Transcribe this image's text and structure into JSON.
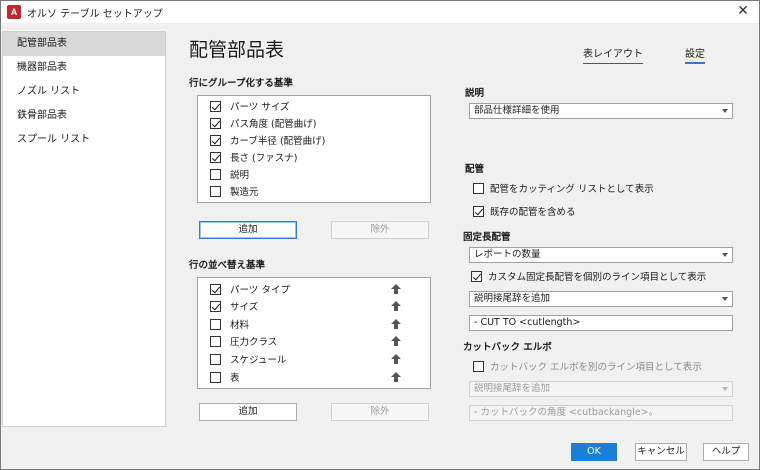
{
  "window": {
    "title": "オルソ テーブル セットアップ",
    "app_icon_letter": "A",
    "close_glyph": "✕"
  },
  "sidebar": {
    "items": [
      {
        "label": "配管部品表",
        "active": true
      },
      {
        "label": "機器部品表",
        "active": false
      },
      {
        "label": "ノズル リスト",
        "active": false
      },
      {
        "label": "鉄骨部品表",
        "active": false
      },
      {
        "label": "スプール リスト",
        "active": false
      }
    ]
  },
  "main": {
    "title": "配管部品表",
    "tabs": [
      {
        "label": "表レイアウト"
      },
      {
        "label": "設定"
      }
    ]
  },
  "group_rows": {
    "label": "行にグループ化する基準",
    "items": [
      {
        "label": "パーツ サイズ",
        "checked": true
      },
      {
        "label": "パス角度 (配管曲げ)",
        "checked": true
      },
      {
        "label": "カーブ半径 (配管曲げ)",
        "checked": true
      },
      {
        "label": "長さ (ファスナ)",
        "checked": true
      },
      {
        "label": "説明",
        "checked": false
      },
      {
        "label": "製造元",
        "checked": false
      }
    ],
    "add_label": "追加",
    "remove_label": "除外"
  },
  "sort_rows": {
    "label": "行の並べ替え基準",
    "items": [
      {
        "label": "パーツ タイプ",
        "checked": true
      },
      {
        "label": "サイズ",
        "checked": true
      },
      {
        "label": "材料",
        "checked": false
      },
      {
        "label": "圧力クラス",
        "checked": false
      },
      {
        "label": "スケジュール",
        "checked": false
      },
      {
        "label": "表",
        "checked": false
      }
    ],
    "add_label": "追加",
    "remove_label": "除外",
    "arrow_icon": "up-arrow-icon"
  },
  "description": {
    "label": "説明",
    "dropdown_value": "部品仕様詳細を使用"
  },
  "piping": {
    "label": "配管",
    "options": [
      {
        "label": "配管をカッティング リストとして表示",
        "checked": false
      },
      {
        "label": "既存の配管を含める",
        "checked": true
      }
    ]
  },
  "fixed_length": {
    "label": "固定長配管",
    "dropdown_value": "レポートの数量",
    "option": {
      "label": "カスタム固定長配管を個別のライン項目として表示",
      "checked": true
    },
    "suffix_dropdown": "説明接尾辞を追加",
    "suffix_value": "- CUT TO <cutlength>"
  },
  "cutback": {
    "label": "カットバック エルボ",
    "option": {
      "label": "カットバック エルボを別のライン項目として表示",
      "checked": false
    },
    "suffix_dropdown": "説明接尾辞を追加",
    "suffix_value": "- カットバックの角度 <cutbackangle>。"
  },
  "footer": {
    "ok": "OK",
    "cancel": "キャンセル",
    "help": "ヘルプ"
  },
  "colors": {
    "accent": "#1a7fd6",
    "app_icon": "#c4262e",
    "tab_underline": "#2e7bcf"
  }
}
